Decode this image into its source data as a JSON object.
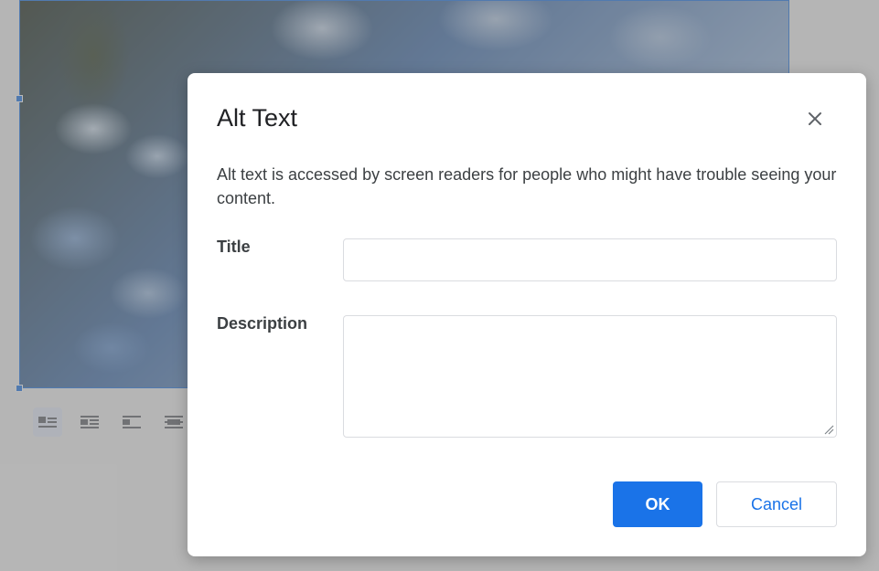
{
  "dialog": {
    "title": "Alt Text",
    "description": "Alt text is accessed by screen readers for people who might have trouble seeing your content.",
    "title_label": "Title",
    "title_value": "",
    "description_label": "Description",
    "description_value": "",
    "ok_label": "OK",
    "cancel_label": "Cancel",
    "close_icon": "close-icon"
  },
  "image_toolbar": {
    "options": [
      "wrap-inline-icon",
      "wrap-text-icon",
      "break-text-icon",
      "behind-text-icon"
    ],
    "selected": "wrap-inline-icon"
  },
  "colors": {
    "accent": "#1a73e8",
    "overlay": "#808080"
  }
}
